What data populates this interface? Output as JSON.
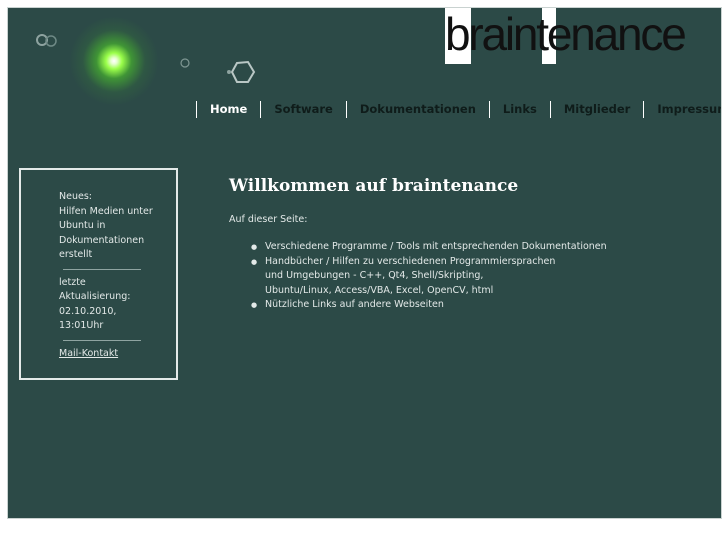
{
  "logo": {
    "prefix": "b",
    "mid1": "rain",
    "mid2": "t",
    "suffix": "enance"
  },
  "nav": {
    "items": [
      {
        "label": "Home"
      },
      {
        "label": "Software"
      },
      {
        "label": "Dokumentationen"
      },
      {
        "label": "Links"
      },
      {
        "label": "Mitglieder"
      },
      {
        "label": "Impressum"
      }
    ]
  },
  "sidebar": {
    "news_lines": [
      "Neues:",
      "Hilfen Medien unter",
      "Ubuntu in",
      "Dokumentationen",
      "erstellt"
    ],
    "update_lines": [
      "letzte",
      "Aktualisierung:",
      "02.10.2010,",
      "13:01Uhr"
    ],
    "mail_label": "Mail-Kontakt"
  },
  "main": {
    "title": "Willkommen auf braintenance",
    "intro": "Auf dieser Seite:",
    "bullets": [
      {
        "lines": [
          "Verschiedene Programme / Tools mit entsprechenden Dokumentationen"
        ]
      },
      {
        "lines": [
          "Handbücher / Hilfen zu verschiedenen Programmiersprachen",
          "und Umgebungen - C++, Qt4, Shell/Skripting,",
          "Ubuntu/Linux, Access/VBA, Excel, OpenCV, html"
        ]
      },
      {
        "lines": [
          "Nützliche Links auf andere Webseiten"
        ]
      }
    ]
  },
  "colors": {
    "background": "#2c4a47",
    "text": "#e3e9e8",
    "nav_text": "#0f1c1a",
    "glow": "#9bff4a"
  },
  "icons": [
    "glow-decoration",
    "bubble-decoration",
    "hexagon-decoration"
  ]
}
